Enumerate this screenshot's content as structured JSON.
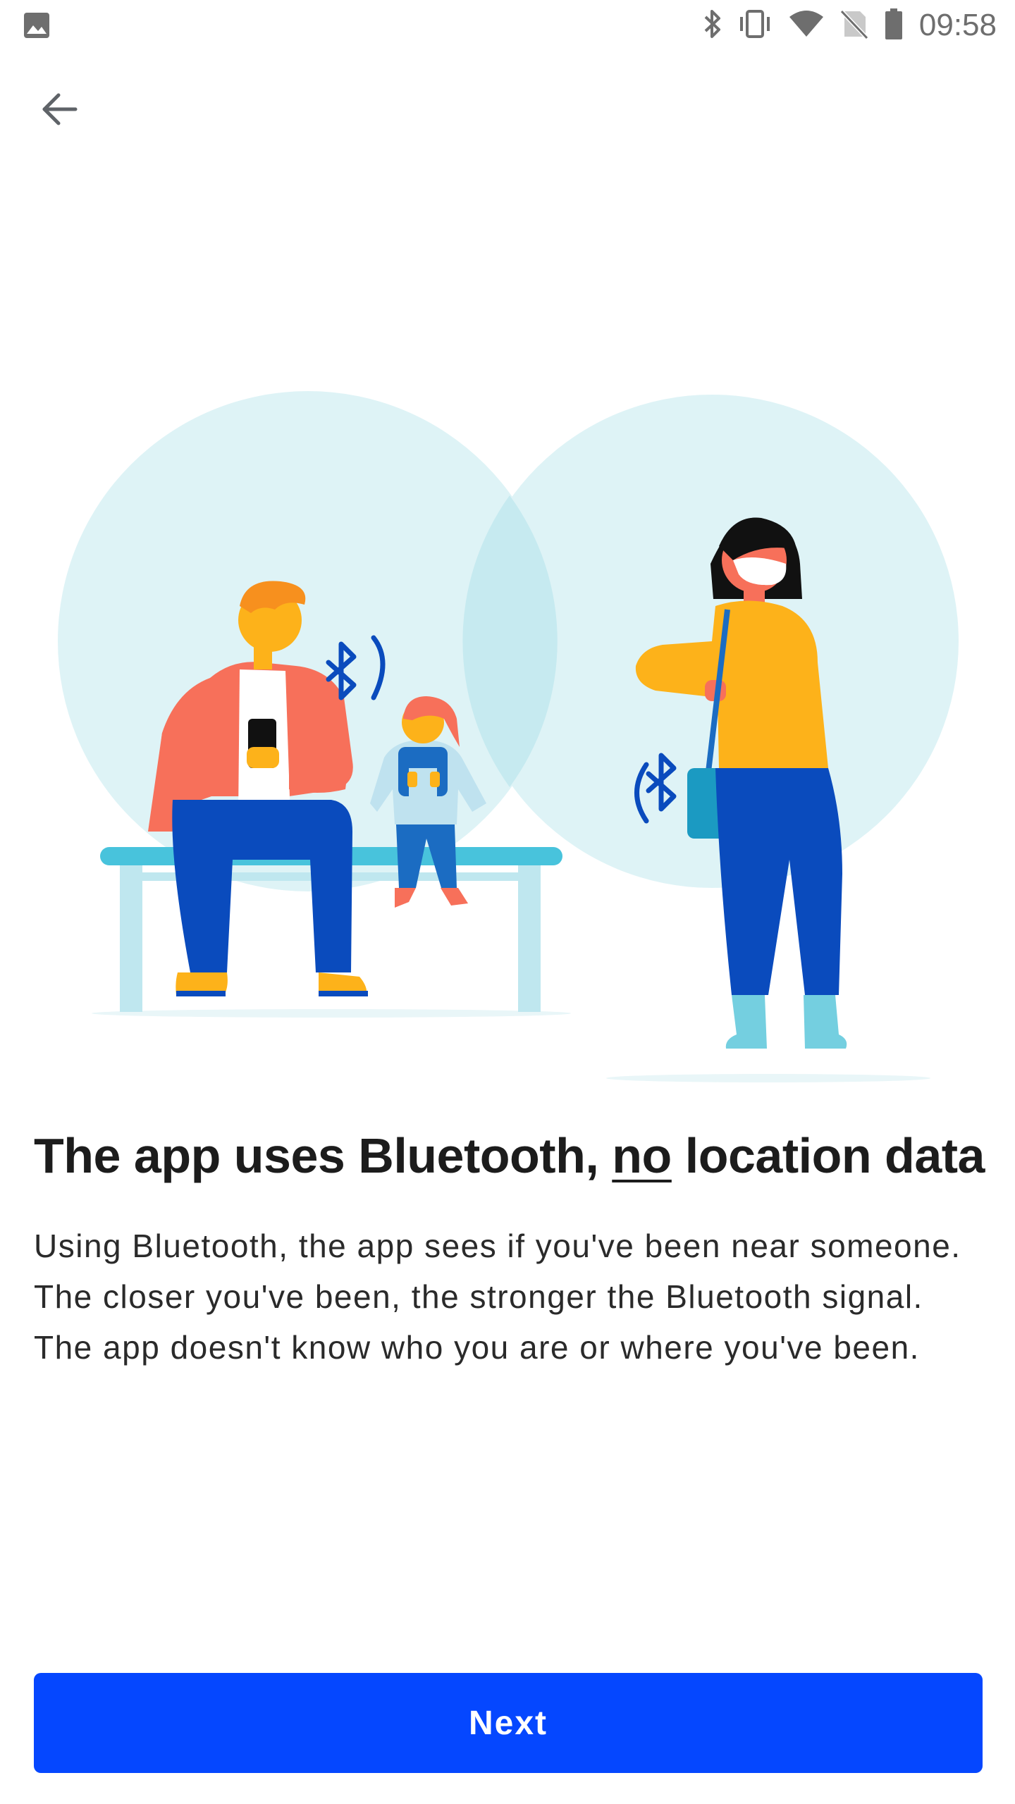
{
  "status_bar": {
    "time": "09:58",
    "icons": [
      "image-notification-icon",
      "bluetooth-icon",
      "vibrate-icon",
      "wifi-icon",
      "no-sim-icon",
      "battery-icon"
    ]
  },
  "navigation": {
    "back_icon": "arrow-left-icon"
  },
  "illustration": {
    "description_icons": [
      "bluetooth-icon",
      "bluetooth-icon"
    ]
  },
  "content": {
    "headline_before": "The app uses Bluetooth, ",
    "headline_emphasis": "no",
    "headline_after": " location data",
    "body": "Using Bluetooth, the app sees if you've been near someone. The closer you've been, the stronger the Bluetooth signal. The app doesn't know who you are or where you've been."
  },
  "actions": {
    "next_label": "Next"
  },
  "colors": {
    "primary": "#0547ff",
    "circle": "#def3f6",
    "circle_overlap": "#c6eaf0",
    "pants_blue": "#0a4bbd",
    "shirt_orange": "#f7705a",
    "skin_yellow": "#fdb21a",
    "bench": "#48c3dc"
  }
}
